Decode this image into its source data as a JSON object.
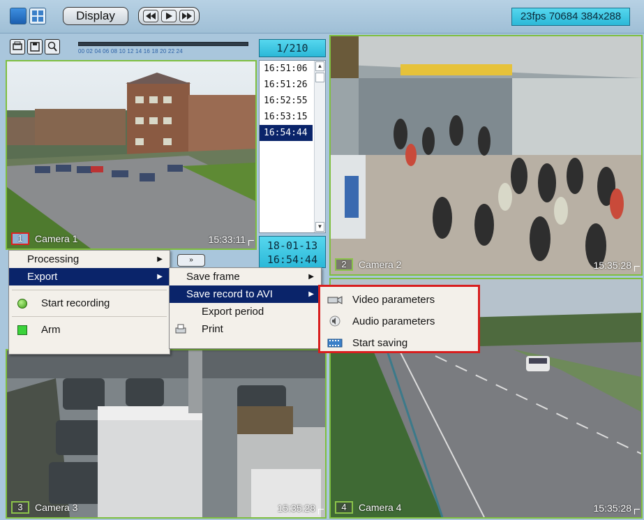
{
  "toolbar": {
    "display_label": "Display",
    "nav_back_icon": "rewind-icon",
    "nav_play_icon": "play-icon",
    "nav_forward_icon": "fast-forward-icon",
    "fps_status": "23fps  70684 384x288"
  },
  "archive": {
    "record_counter": "1/210",
    "timeline_ticks": "00 02 04 06 08 10  12 14  16  18  20 22 24",
    "timestamps": [
      "16:51:06",
      "16:51:26",
      "16:52:55",
      "16:53:15",
      "16:54:44"
    ],
    "selected_index": 4,
    "date": "18-01-13",
    "time": "16:54:44"
  },
  "cameras": [
    {
      "num": "1",
      "name": "Camera 1",
      "time": "15:33:11"
    },
    {
      "num": "2",
      "name": "Camera 2",
      "time": "15:35:28"
    },
    {
      "num": "3",
      "name": "Camera 3",
      "time": "15:35:28"
    },
    {
      "num": "4",
      "name": "Camera 4",
      "time": "15:35:28"
    }
  ],
  "context_menu": {
    "items": {
      "processing": "Processing",
      "export": "Export",
      "start_recording": "Start recording",
      "arm": "Arm"
    },
    "export_submenu": {
      "save_frame": "Save frame",
      "save_record_avi": "Save record to AVI",
      "export_period": "Export period",
      "print": "Print"
    },
    "avi_submenu": {
      "video_parameters": "Video parameters",
      "audio_parameters": "Audio parameters",
      "start_saving": "Start saving"
    }
  },
  "colors": {
    "accent_highlight": "#0a246a",
    "frame_border": "#7fbf3f",
    "callout_red": "#d81e1e",
    "status_cyan": "#2bb8d8"
  }
}
